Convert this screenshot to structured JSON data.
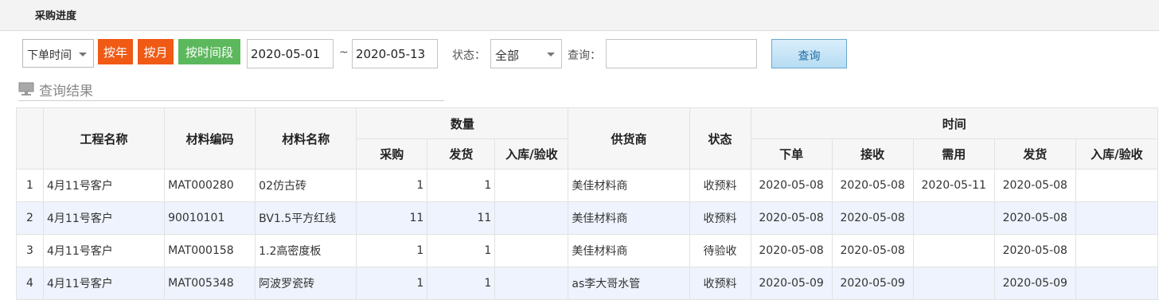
{
  "page_title": "采购进度",
  "filters": {
    "time_type": "下单时间",
    "btn_year": "按年",
    "btn_month": "按月",
    "btn_range": "按时间段",
    "date_start": "2020-05-01",
    "tilde": "~",
    "date_end": "2020-05-13",
    "status_label": "状态：",
    "status_value": "全部",
    "query_label": "查询：",
    "query_value": "",
    "search_button": "查询"
  },
  "results_title": "查询结果",
  "columns": {
    "project": "工程名称",
    "code": "材料编码",
    "name": "材料名称",
    "quantity_group": "数量",
    "purchase": "采购",
    "shipped": "发货",
    "received": "入库/验收",
    "supplier": "供货商",
    "status": "状态",
    "time_group": "时间",
    "ordered": "下单",
    "accepted": "接收",
    "needed": "需用",
    "ship_date": "发货",
    "stock_date": "入库/验收"
  },
  "rows": [
    {
      "idx": "1",
      "project": "4月11号客户",
      "code": "MAT000280",
      "name": "02仿古砖",
      "purchase": "1",
      "shipped": "1",
      "received": "",
      "supplier": "美佳材料商",
      "status": "收预料",
      "ordered": "2020-05-08",
      "accepted": "2020-05-08",
      "needed": "2020-05-11",
      "ship_date": "2020-05-08",
      "stock_date": ""
    },
    {
      "idx": "2",
      "project": "4月11号客户",
      "code": "90010101",
      "name": "BV1.5平方红线",
      "purchase": "11",
      "shipped": "11",
      "received": "",
      "supplier": "美佳材料商",
      "status": "收预料",
      "ordered": "2020-05-08",
      "accepted": "2020-05-08",
      "needed": "",
      "ship_date": "2020-05-08",
      "stock_date": ""
    },
    {
      "idx": "3",
      "project": "4月11号客户",
      "code": "MAT000158",
      "name": "1.2高密度板",
      "purchase": "1",
      "shipped": "1",
      "received": "",
      "supplier": "美佳材料商",
      "status": "待验收",
      "ordered": "2020-05-08",
      "accepted": "2020-05-08",
      "needed": "",
      "ship_date": "2020-05-08",
      "stock_date": ""
    },
    {
      "idx": "4",
      "project": "4月11号客户",
      "code": "MAT005348",
      "name": "阿波罗瓷砖",
      "purchase": "1",
      "shipped": "1",
      "received": "",
      "supplier": "as李大哥水管",
      "status": "收预料",
      "ordered": "2020-05-09",
      "accepted": "2020-05-09",
      "needed": "",
      "ship_date": "2020-05-09",
      "stock_date": ""
    }
  ]
}
